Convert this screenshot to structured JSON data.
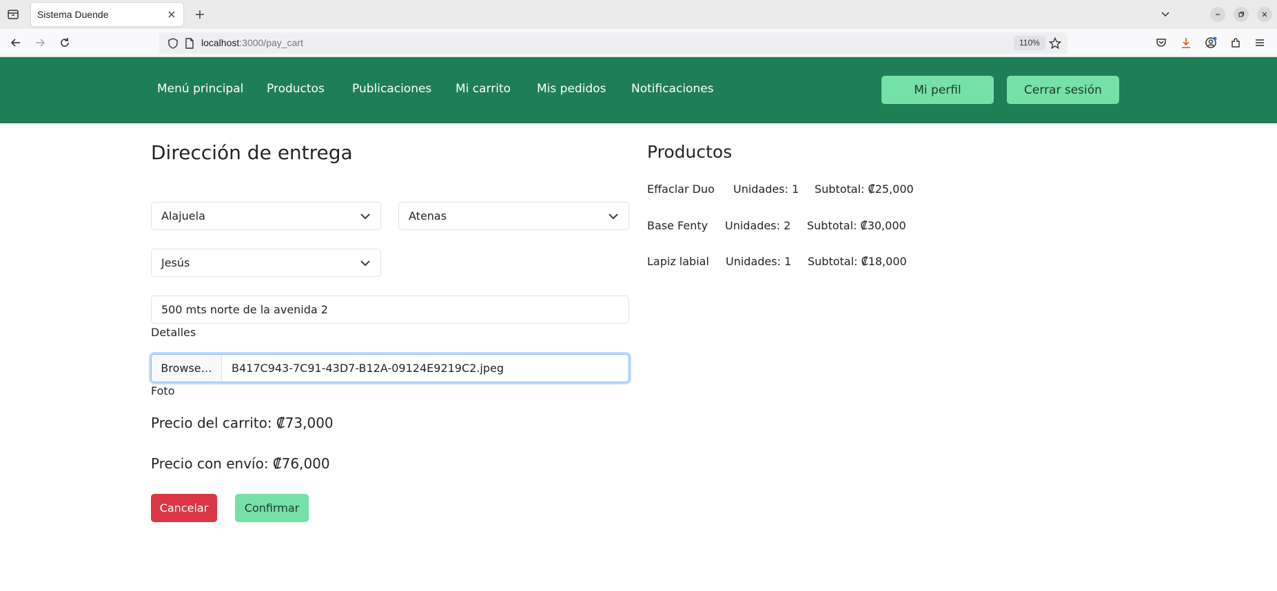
{
  "browser": {
    "tab_title": "Sistema Duende",
    "url_host": "localhost",
    "url_path": ":3000/pay_cart",
    "zoom": "110%"
  },
  "header": {
    "menu": [
      "Menú principal",
      "Productos",
      "Publicaciones",
      "Mi carrito",
      "Mis pedidos",
      "Notificaciones"
    ],
    "profile_label": "Mi perfil",
    "logout_label": "Cerrar sesión"
  },
  "delivery": {
    "title": "Dirección de entrega",
    "province": "Alajuela",
    "canton": "Atenas",
    "district": "Jesús",
    "details_value": "500 mts norte de la avenida 2",
    "details_label": "Detalles",
    "file_button": "Browse…",
    "file_name": "B417C943-7C91-43D7-B12A-09124E9219C2.jpeg",
    "photo_label": "Foto",
    "cart_price": "Precio del carrito: ₡73,000",
    "shipping_price": "Precio con envío: ₡76,000",
    "cancel_label": "Cancelar",
    "confirm_label": "Confirmar"
  },
  "products": {
    "title": "Productos",
    "items": [
      {
        "name": "Effaclar Duo",
        "units": "Unidades: 1",
        "subtotal": "Subtotal: ₡25,000"
      },
      {
        "name": "Base Fenty",
        "units": "Unidades: 2",
        "subtotal": "Subtotal: ₡30,000"
      },
      {
        "name": "Lapiz labial",
        "units": "Unidades: 1",
        "subtotal": "Subtotal: ₡18,000"
      }
    ]
  },
  "colors": {
    "header_bg": "#1e7e56",
    "accent_btn": "#75e0a7",
    "danger": "#dc3545"
  }
}
